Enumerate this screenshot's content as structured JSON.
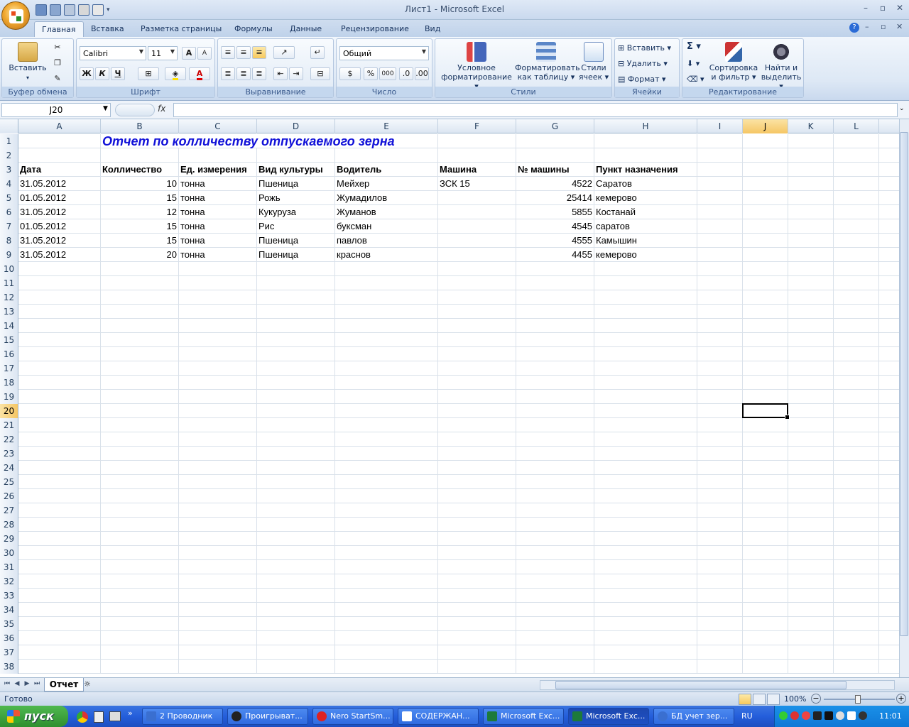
{
  "window": {
    "title": "Лист1 - Microsoft Excel"
  },
  "tabs": [
    "Главная",
    "Вставка",
    "Разметка страницы",
    "Формулы",
    "Данные",
    "Рецензирование",
    "Вид"
  ],
  "ribbon": {
    "clipboard": {
      "label": "Буфер обмена",
      "paste": "Вставить"
    },
    "font": {
      "label": "Шрифт",
      "name": "Calibri",
      "size": "11",
      "bold": "Ж",
      "italic": "К",
      "underline": "Ч",
      "grow": "A",
      "shrink": "A"
    },
    "alignment": {
      "label": "Выравнивание"
    },
    "number": {
      "label": "Число",
      "format": "Общий",
      "percent": "%",
      "thousands": "000"
    },
    "styles": {
      "label": "Стили",
      "conditional": "Условное форматирование",
      "as_table": "Форматировать как таблицу",
      "cell_styles": "Стили ячеек"
    },
    "cells": {
      "label": "Ячейки",
      "insert": "Вставить",
      "delete": "Удалить",
      "format": "Формат"
    },
    "editing": {
      "label": "Редактирование",
      "sigma": "Σ",
      "sort": "Сортировка и фильтр",
      "find": "Найти и выделить"
    }
  },
  "formula_bar": {
    "name_box": "J20",
    "fx": "fx",
    "value": ""
  },
  "columns": [
    "A",
    "B",
    "C",
    "D",
    "E",
    "F",
    "G",
    "H",
    "I",
    "J",
    "K",
    "L"
  ],
  "selected": {
    "col": "J",
    "row": 20
  },
  "sheet": {
    "title": "Отчет по колличеству отпускаемого зерна",
    "headers": [
      "Дата",
      "Колличество",
      "Ед. измерения",
      "Вид культуры",
      "Водитель",
      "Машина",
      "№ машины",
      "Пункт назначения"
    ],
    "rows": [
      [
        "31.05.2012",
        "10",
        "тонна",
        "Пшеница",
        "Мейхер",
        "ЗСК 15",
        "4522",
        "Саратов"
      ],
      [
        "01.05.2012",
        "15",
        "тонна",
        "Рожь",
        "Жумадилов",
        "",
        "25414",
        "кемерово"
      ],
      [
        "31.05.2012",
        "12",
        "тонна",
        "Кукуруза",
        "Жуманов",
        "",
        "5855",
        "Костанай"
      ],
      [
        "01.05.2012",
        "15",
        "тонна",
        "Рис",
        "буксман",
        "",
        "4545",
        "саратов"
      ],
      [
        "31.05.2012",
        "15",
        "тонна",
        "Пшеница",
        "павлов",
        "",
        "4555",
        "Камышин"
      ],
      [
        "31.05.2012",
        "20",
        "тонна",
        "Пшеница",
        "краснов",
        "",
        "4455",
        "кемерово"
      ]
    ]
  },
  "sheet_tabs": {
    "active": "Отчет"
  },
  "status": {
    "text": "Готово",
    "zoom": "100%"
  },
  "taskbar": {
    "start": "пуск",
    "items": [
      "2 Проводник",
      "Проигрыват...",
      "Nero StartSm...",
      "СОДЕРЖАН...",
      "Microsoft Exc...",
      "Microsoft Exc...",
      "БД учет зер..."
    ],
    "lang": "RU",
    "clock": "11:01"
  }
}
